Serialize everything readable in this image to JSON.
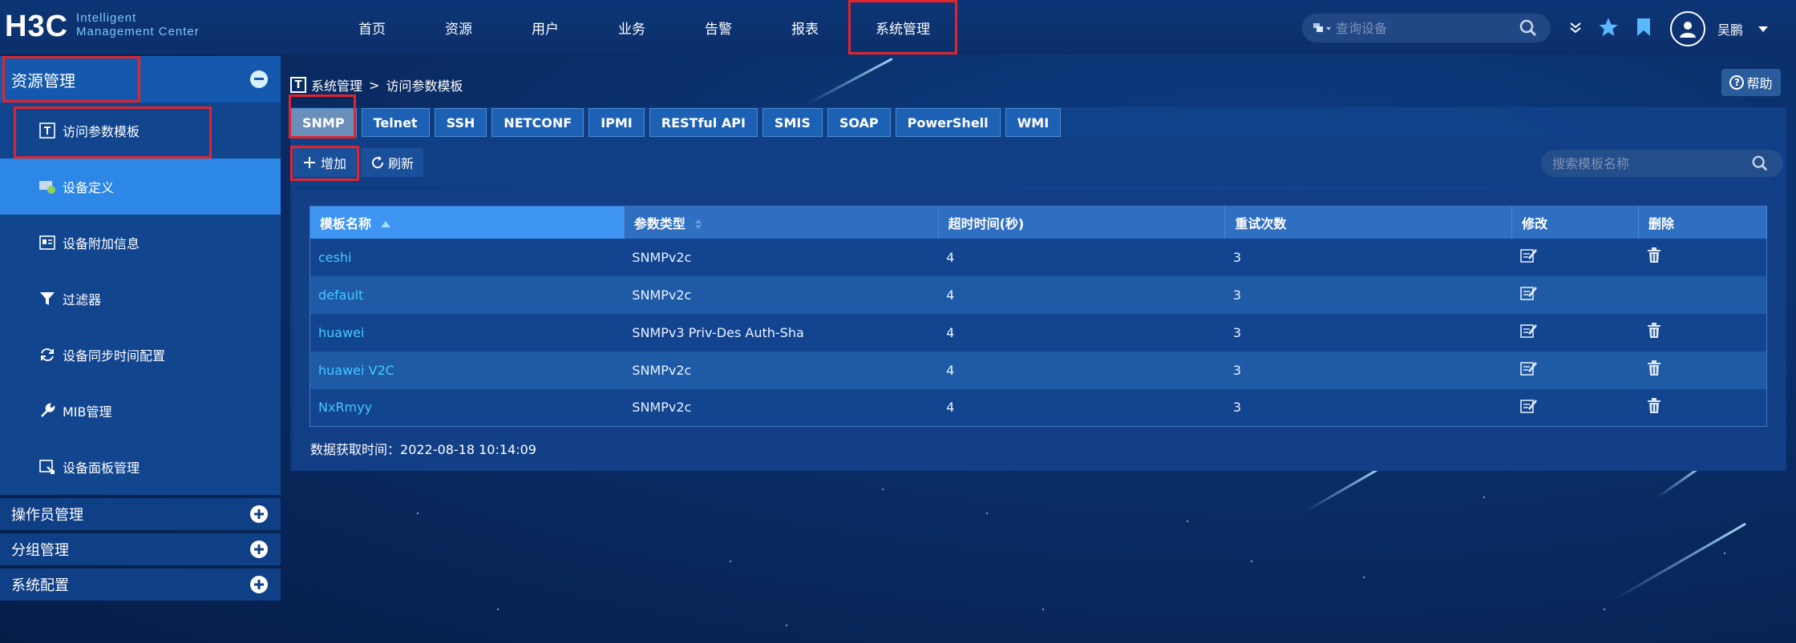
{
  "header": {
    "logo_mark": "H3C",
    "logo_sub_line1": "Intelligent",
    "logo_sub_line2": "Management Center",
    "nav": [
      "首页",
      "资源",
      "用户",
      "业务",
      "告警",
      "报表",
      "系统管理"
    ],
    "active_nav": "系统管理",
    "search_placeholder": "查询设备",
    "user_name": "吴鹏"
  },
  "sidebar": {
    "section_title": "资源管理",
    "items": [
      {
        "label": "访问参数模板",
        "icon": "template-icon"
      },
      {
        "label": "设备定义",
        "icon": "device-definition-icon"
      },
      {
        "label": "设备附加信息",
        "icon": "device-info-card-icon"
      },
      {
        "label": "过滤器",
        "icon": "filter-icon"
      },
      {
        "label": "设备同步时间配置",
        "icon": "sync-icon"
      },
      {
        "label": "MIB管理",
        "icon": "wrench-icon"
      },
      {
        "label": "设备面板管理",
        "icon": "device-panel-icon"
      }
    ],
    "groups": [
      "操作员管理",
      "分组管理",
      "系统配置"
    ]
  },
  "breadcrumb": {
    "icon_letter": "T",
    "root": "系统管理",
    "separator": ">",
    "current": "访问参数模板"
  },
  "help_label": "帮助",
  "help_glyph": "?",
  "tabs": [
    "SNMP",
    "Telnet",
    "SSH",
    "NETCONF",
    "IPMI",
    "RESTful API",
    "SMIS",
    "SOAP",
    "PowerShell",
    "WMI"
  ],
  "active_tab": "SNMP",
  "toolbar": {
    "add_label": "增加",
    "refresh_label": "刷新",
    "search_placeholder": "搜索模板名称"
  },
  "table": {
    "columns": [
      "模板名称",
      "参数类型",
      "超时时间(秒)",
      "重试次数",
      "修改",
      "删除"
    ],
    "rows": [
      {
        "name": "ceshi",
        "type": "SNMPv2c",
        "timeout": "4",
        "retries": "3",
        "deletable": true
      },
      {
        "name": "default",
        "type": "SNMPv2c",
        "timeout": "4",
        "retries": "3",
        "deletable": false
      },
      {
        "name": "huawei",
        "type": "SNMPv3 Priv-Des Auth-Sha",
        "timeout": "4",
        "retries": "3",
        "deletable": true
      },
      {
        "name": "huawei V2C",
        "type": "SNMPv2c",
        "timeout": "4",
        "retries": "3",
        "deletable": true
      },
      {
        "name": "NxRmyy",
        "type": "SNMPv2c",
        "timeout": "4",
        "retries": "3",
        "deletable": true
      }
    ]
  },
  "fetch_time_label": "数据获取时间：",
  "fetch_time_value": "2022-08-18 10:14:09",
  "colors": {
    "highlight_box": "#e2242c",
    "link": "#46c8ff",
    "selected_sidebar": "#2c87e6"
  }
}
